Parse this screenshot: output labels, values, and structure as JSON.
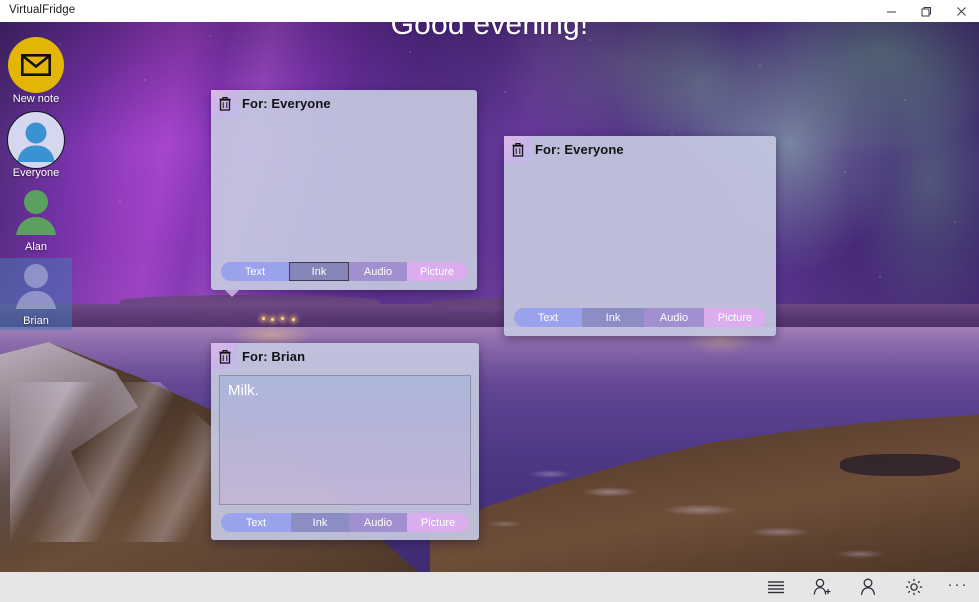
{
  "window": {
    "title": "VirtualFridge",
    "controls": [
      {
        "name": "minimize-button",
        "glyph": "minimize"
      },
      {
        "name": "maximize-button",
        "glyph": "restore"
      },
      {
        "name": "close-button",
        "glyph": "close"
      }
    ]
  },
  "header": {
    "greeting": "Good evening!"
  },
  "sidebar": {
    "items": [
      {
        "label": "New note",
        "icon": "envelope-icon",
        "kind": "newnote",
        "selected": false
      },
      {
        "label": "Everyone",
        "icon": "person-icon",
        "kind": "everyone",
        "selected": false
      },
      {
        "label": "Alan",
        "icon": "person-icon",
        "kind": "person-green",
        "selected": false
      },
      {
        "label": "Brian",
        "icon": "person-icon",
        "kind": "person-photo",
        "selected": true
      }
    ]
  },
  "notes": [
    {
      "title": "For: Everyone",
      "delete_icon": "trash-icon",
      "body_text": "",
      "has_text_area": false,
      "modes": [
        {
          "label": "Text",
          "state": "normal"
        },
        {
          "label": "Ink",
          "state": "hovered"
        },
        {
          "label": "Audio",
          "state": "normal"
        },
        {
          "label": "Picture",
          "state": "normal"
        }
      ]
    },
    {
      "title": "For: Everyone",
      "delete_icon": "trash-icon",
      "body_text": "",
      "has_text_area": false,
      "modes": [
        {
          "label": "Text",
          "state": "normal"
        },
        {
          "label": "Ink",
          "state": "normal"
        },
        {
          "label": "Audio",
          "state": "normal"
        },
        {
          "label": "Picture",
          "state": "normal"
        }
      ]
    },
    {
      "title": "For: Brian",
      "delete_icon": "trash-icon",
      "body_text": "Milk.",
      "has_text_area": true,
      "modes": [
        {
          "label": "Text",
          "state": "normal"
        },
        {
          "label": "Ink",
          "state": "normal"
        },
        {
          "label": "Audio",
          "state": "normal"
        },
        {
          "label": "Picture",
          "state": "normal"
        }
      ]
    }
  ],
  "command_bar": {
    "items": [
      {
        "name": "notes-list-button",
        "icon": "list-icon"
      },
      {
        "name": "add-person-button",
        "icon": "person-add-icon"
      },
      {
        "name": "person-button",
        "icon": "person-icon"
      },
      {
        "name": "settings-button",
        "icon": "gear-icon"
      },
      {
        "name": "more-button",
        "icon": "ellipsis-icon",
        "label": "···"
      }
    ]
  },
  "colors": {
    "accent_yellow": "#e3b505",
    "accent_green": "#5ba05e",
    "accent_blue": "#3a92d2",
    "card_bg": "#c4c7e0",
    "seg_text": "#9aa2ee",
    "seg_ink": "#8d8dc5",
    "seg_audio": "#a18fd0",
    "seg_picture": "#dbadef",
    "command_bar_bg": "#e6e6e6"
  }
}
